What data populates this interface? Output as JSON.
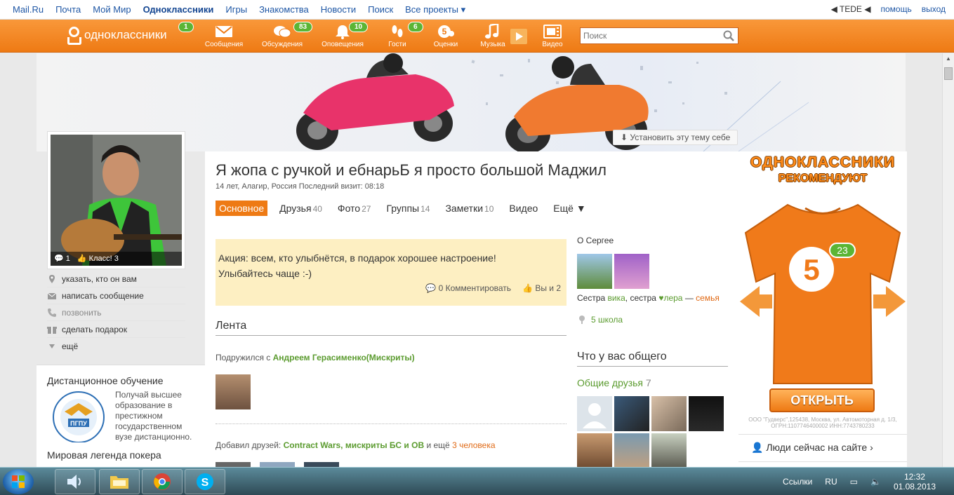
{
  "topbar": {
    "links": [
      "Mail.Ru",
      "Почта",
      "Мой Мир",
      "Одноклассники",
      "Игры",
      "Знакомства",
      "Новости",
      "Поиск",
      "Все проекты ▾"
    ],
    "active_index": 3,
    "user": "◀ TEDE ◀",
    "help": "помощь",
    "logout": "выход"
  },
  "toolbar": {
    "logo": "одноклассники",
    "logo_badge": "1",
    "items": [
      {
        "label": "Сообщения",
        "icon": "envelope-icon",
        "badge": ""
      },
      {
        "label": "Обсуждения",
        "icon": "chat-bubbles-icon",
        "badge": "83"
      },
      {
        "label": "Оповещения",
        "icon": "bell-icon",
        "badge": "10"
      },
      {
        "label": "Гости",
        "icon": "footprints-icon",
        "badge": "6"
      },
      {
        "label": "Оценки",
        "icon": "five-rating-icon",
        "badge": ""
      },
      {
        "label": "Музыка",
        "icon": "music-note-icon",
        "badge": ""
      },
      {
        "label": "Видео",
        "icon": "film-icon",
        "badge": ""
      }
    ],
    "search_placeholder": "Поиск"
  },
  "banner": {
    "theme_button": "Установить эту тему себе"
  },
  "left": {
    "avatar_comments": "1",
    "avatar_class": "Класс! 3",
    "links": [
      {
        "label": "указать, кто он вам",
        "icon": "pin-icon"
      },
      {
        "label": "написать сообщение",
        "icon": "envelope-icon"
      },
      {
        "label": "позвонить",
        "icon": "phone-icon"
      },
      {
        "label": "сделать подарок",
        "icon": "gift-icon"
      },
      {
        "label": "ещё",
        "icon": "triangle-down-icon"
      }
    ],
    "promo_title": "Дистанционное обучение",
    "promo_logo_text": "ПГПУ",
    "promo_text": "Получай высшее образование в престижном государственном вузе дистанционно.",
    "promo2_title": "Мировая легенда покера"
  },
  "profile": {
    "name": "Я жопа с ручкой и ебнарьБ я просто большой Маджил",
    "meta": "14 лет, Алагир, Россия  Последний визит: 08:18",
    "tabs": [
      {
        "label": "Основное",
        "count": ""
      },
      {
        "label": "Друзья",
        "count": "40"
      },
      {
        "label": "Фото",
        "count": "27"
      },
      {
        "label": "Группы",
        "count": "14"
      },
      {
        "label": "Заметки",
        "count": "10"
      },
      {
        "label": "Видео",
        "count": ""
      },
      {
        "label": "Ещё ▼",
        "count": ""
      }
    ],
    "status_text": "Акция: всем, кто улыбнётся, в подарок хорошее настроение! Улыбайтесь чаще :-)",
    "status_comments": "0",
    "status_comment_label": "Комментировать",
    "status_likes": "Вы и 2"
  },
  "feed": {
    "title": "Лента",
    "item1_prefix": "Подружился с",
    "item1_name": "Андреем Герасименко(Мискриты)",
    "item2_prefix": "Добавил друзей:",
    "item2_names": "Contract Wars, мискриты БС и ОВ",
    "item2_more_prefix": "и ещё",
    "item2_more": "3 человека"
  },
  "side": {
    "about": "О Сергее",
    "rel1_prefix": "Сестра",
    "rel1_name": "вика",
    "rel_sep": ", сестра",
    "rel2_name": "♥лера",
    "rel_dash": "—",
    "rel_family": "семья",
    "school": "5 школа",
    "common_title": "Что у вас общего",
    "friends_label": "Общие друзья",
    "friends_count": "7"
  },
  "ad": {
    "title1": "ОДНОКЛАССНИКИ",
    "title2": "РЕКОМЕНДУЮТ",
    "shirt_number": "5",
    "shirt_badge": "23",
    "open_button": "ОТКРЫТЬ",
    "legal": "ООО \"Гудверс\",125438, Москва, ул. Автомоторная д. 1/3, ОГРН:1107746400002 ИНН:7743780233",
    "people_online": "Люди сейчас на сайте ›"
  },
  "taskbar": {
    "links_label": "Ссылки",
    "lang": "RU",
    "time": "12:32",
    "date": "01.08.2013"
  }
}
